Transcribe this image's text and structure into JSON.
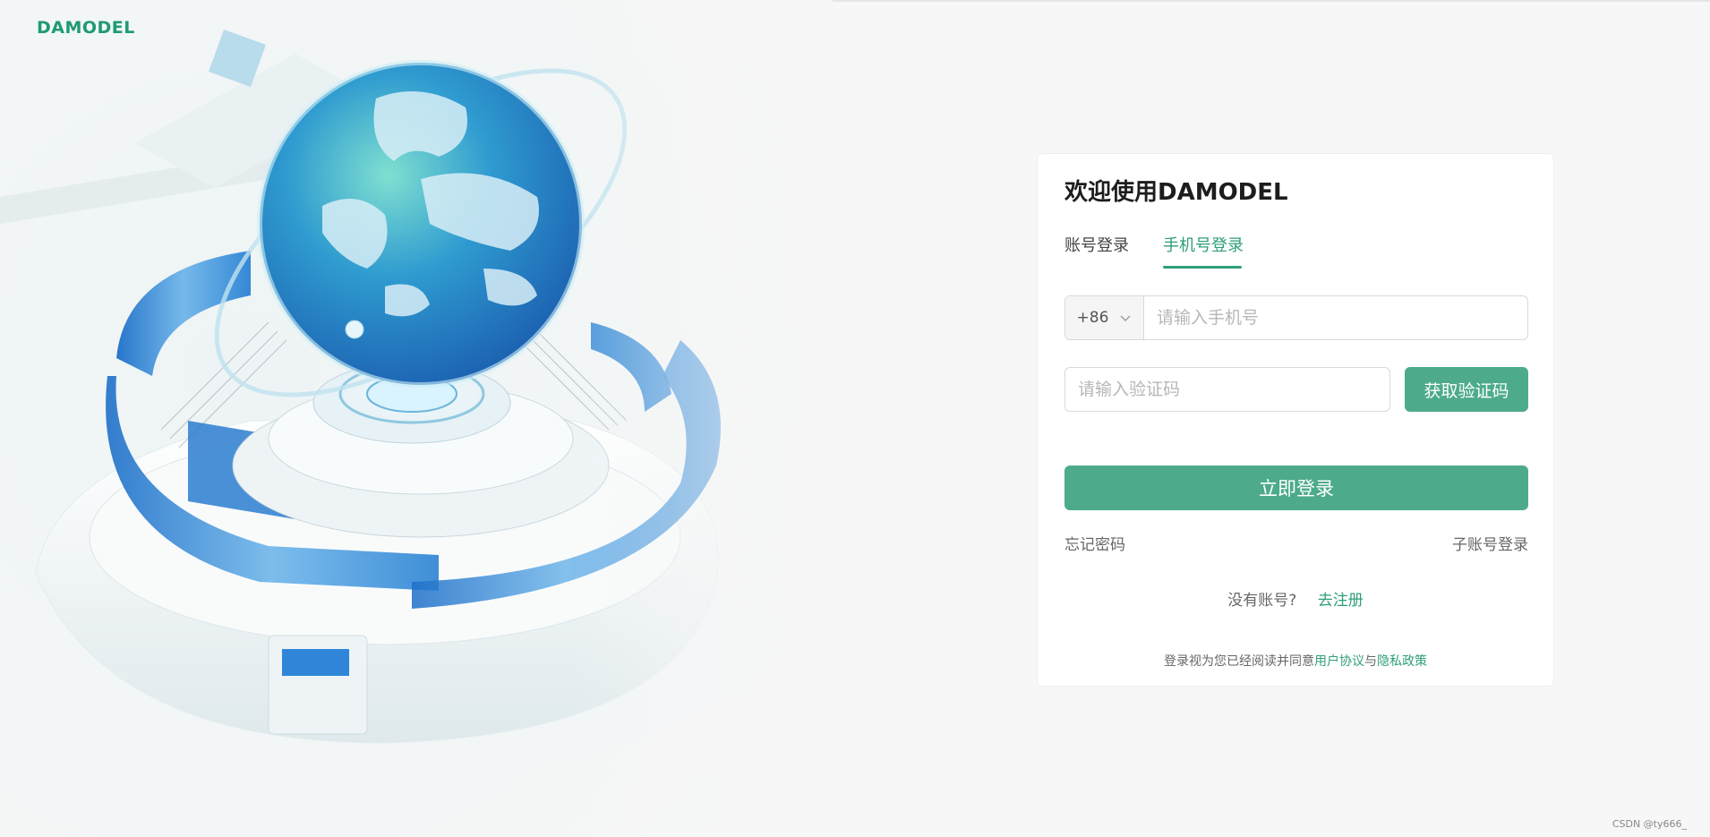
{
  "brand": {
    "logo_text": "DAMODEL",
    "accent_color": "#4dab8c",
    "link_color": "#2f9e7a"
  },
  "hero": {
    "illustration": "globe-on-platform"
  },
  "login": {
    "title": "欢迎使用DAMODEL",
    "tabs": [
      {
        "label": "账号登录",
        "active": false
      },
      {
        "label": "手机号登录",
        "active": true
      }
    ],
    "country_code": "+86",
    "phone_placeholder": "请输入手机号",
    "code_placeholder": "请输入验证码",
    "get_code_label": "获取验证码",
    "submit_label": "立即登录",
    "forgot_password": "忘记密码",
    "sub_account_login": "子账号登录",
    "no_account_text": "没有账号?",
    "register_link": "去注册",
    "agreement_prefix": "登录视为您已经阅读并同意",
    "user_agreement": "用户协议",
    "agreement_and": "与",
    "privacy_policy": "隐私政策"
  },
  "watermark": "CSDN @ty666_"
}
